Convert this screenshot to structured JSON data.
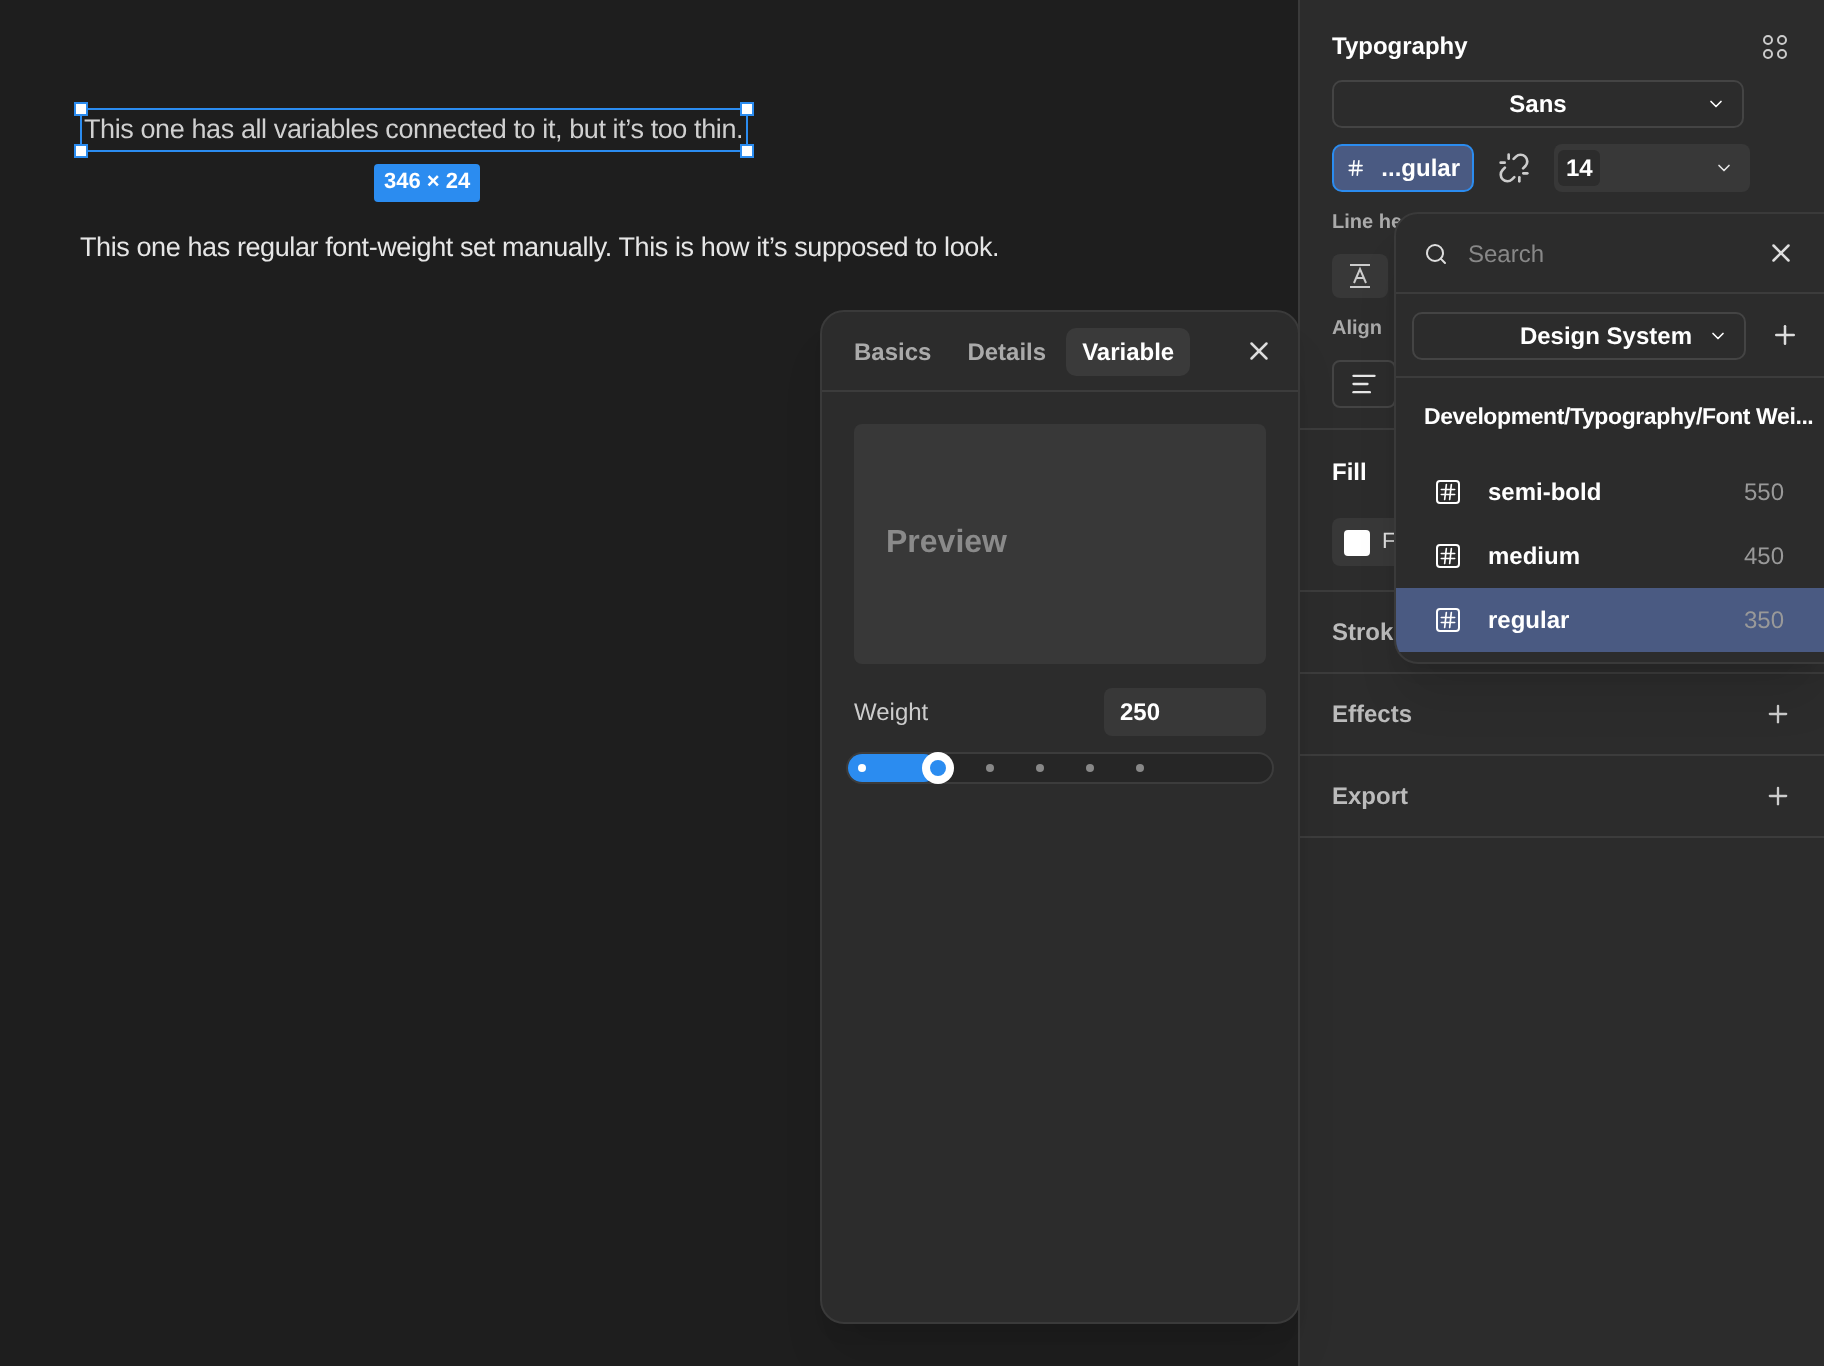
{
  "canvas": {
    "selected_text": "This one has all variables connected to it, but it’s too thin.",
    "size_badge": "346 × 24",
    "text": "This one has regular font-weight set manually. This is how it’s supposed to look."
  },
  "variable_popover": {
    "tabs": [
      {
        "label": "Basics",
        "selected": false
      },
      {
        "label": "Details",
        "selected": false
      },
      {
        "label": "Variable",
        "selected": true
      }
    ],
    "preview": "Preview",
    "weight_label": "Weight",
    "weight_value": "250",
    "level": 0.21
  },
  "panel": {
    "typography_title": "Typography",
    "font": "Sans",
    "style_chip": "...gular",
    "size": "14",
    "line_height_label": "Line he",
    "alignment_label": "Align",
    "fill_title": "Fill",
    "fill_value": "F",
    "stroke_title": "Strok",
    "sections": [
      {
        "title": "Effects"
      },
      {
        "title": "Export"
      }
    ]
  },
  "dropdown": {
    "search_placeholder": "Search",
    "library": "Design System",
    "group": "Development/Typography/Font Wei...",
    "items": [
      {
        "name": "semi-bold",
        "value": "550",
        "selected": false
      },
      {
        "name": "medium",
        "value": "450",
        "selected": false
      },
      {
        "name": "regular",
        "value": "350",
        "selected": true
      }
    ]
  }
}
